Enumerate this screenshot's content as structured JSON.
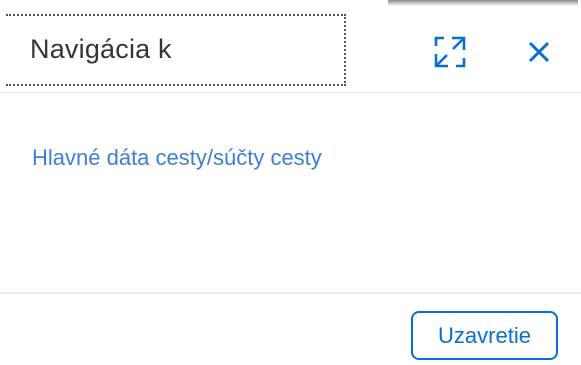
{
  "dialog": {
    "title": "Navigácia k",
    "expand_icon": "expand-arrows-icon",
    "close_icon": "close-x-icon"
  },
  "content": {
    "link_text": "Hlavné dáta cesty/súčty cesty"
  },
  "footer": {
    "close_button_label": "Uzavretie"
  },
  "colors": {
    "accent": "#0a6ed1",
    "link": "#3e7ed6",
    "title_text": "#32363a"
  }
}
